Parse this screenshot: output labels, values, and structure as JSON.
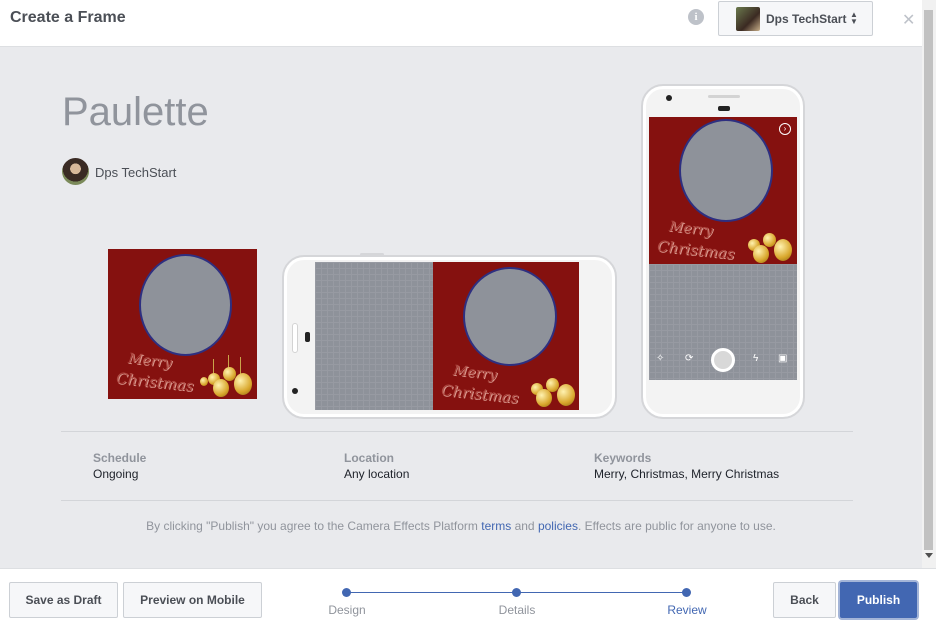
{
  "header": {
    "title": "Create a Frame",
    "info_icon": "info-icon",
    "account_name": "Dps TechStart",
    "close_icon": "close-icon"
  },
  "effect": {
    "name": "Paulette",
    "creator": "Dps TechStart"
  },
  "frame_art": {
    "text_line1": "Merry",
    "text_line2": "Christmas",
    "background_color": "#85110f"
  },
  "details": {
    "schedule_label": "Schedule",
    "schedule_value": "Ongoing",
    "location_label": "Location",
    "location_value": "Any location",
    "keywords_label": "Keywords",
    "keywords_value": "Merry, Christmas, Merry Christmas"
  },
  "legal": {
    "prefix": "By clicking \"Publish\" you agree to the Camera Effects Platform ",
    "terms": "terms",
    "and": " and ",
    "policies": "policies",
    "suffix": ". Effects are public for anyone to use."
  },
  "footer": {
    "save_draft": "Save as Draft",
    "preview_mobile": "Preview on Mobile",
    "back": "Back",
    "publish": "Publish",
    "steps": [
      "Design",
      "Details",
      "Review"
    ],
    "active_step": "Review"
  },
  "colors": {
    "accent": "#4267b2"
  }
}
